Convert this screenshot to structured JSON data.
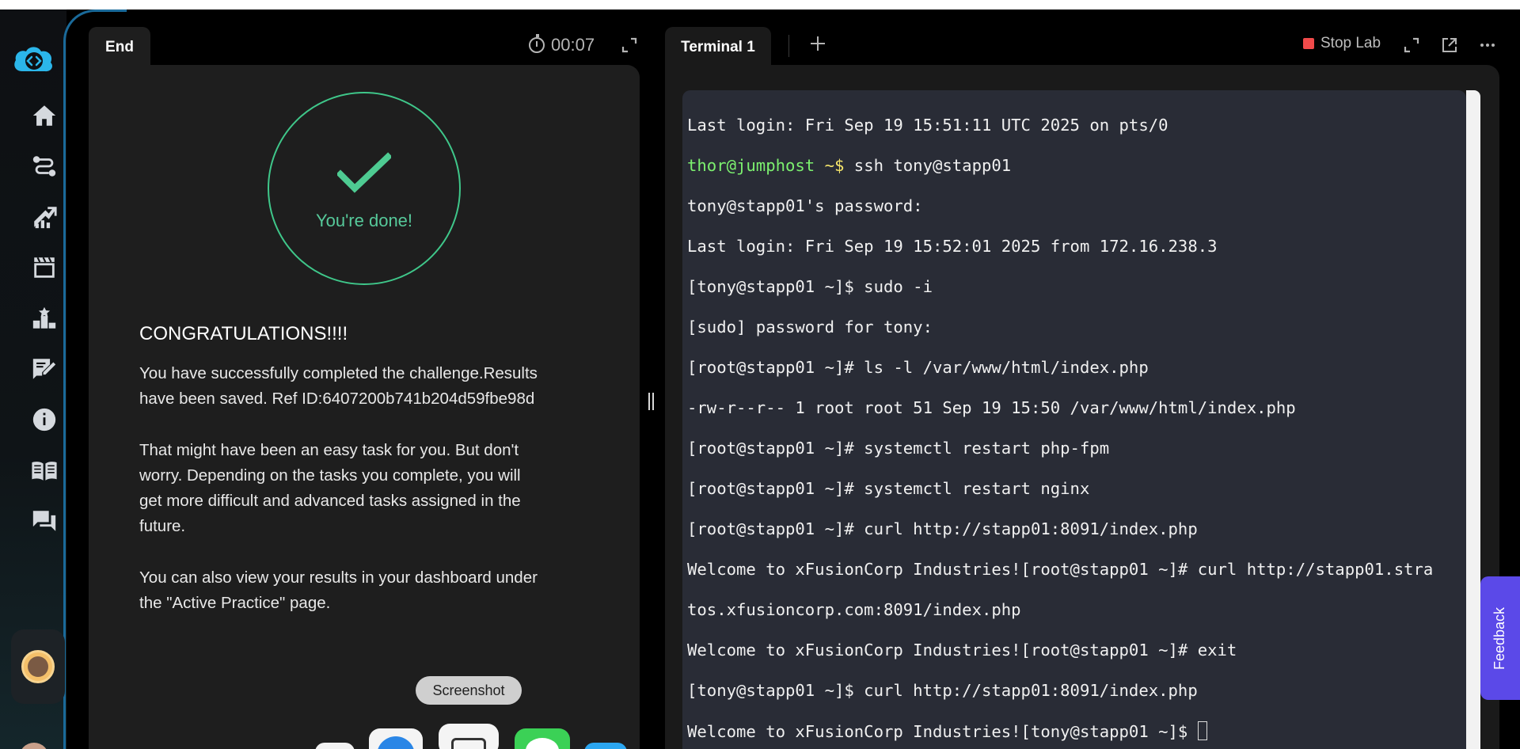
{
  "left_tab": {
    "label": "End"
  },
  "timer": {
    "value": "00:07"
  },
  "result": {
    "done_text": "You're done!",
    "heading": "CONGRATULATIONS!!!!",
    "para1_line1": "You have successfully completed the challenge.Results",
    "para1_line2": "have been saved. Ref ID:6407200b741b204d59fbe98d",
    "para2_line1": "That might have been an easy task for you. But don't",
    "para2_line2": "worry. Depending on the tasks you complete, you will",
    "para2_line3": "get more difficult and advanced tasks assigned in the",
    "para2_line4": "future.",
    "para3_line1": "You can also view your results in your dashboard under",
    "para3_line2": "the \"Active Practice\" page."
  },
  "dock": {
    "tooltip": "Screenshot"
  },
  "right_tab": {
    "label": "Terminal 1"
  },
  "toolbar": {
    "stop_label": "Stop Lab"
  },
  "terminal": {
    "l1": "Last login: Fri Sep 19 15:51:11 UTC 2025 on pts/0",
    "l2_user": "thor@jumphost",
    "l2_path": " ~$",
    "l2_cmd": " ssh tony@stapp01",
    "l3": "tony@stapp01's password:",
    "l4": "Last login: Fri Sep 19 15:52:01 2025 from 172.16.238.3",
    "l5": "[tony@stapp01 ~]$ sudo -i",
    "l6": "[sudo] password for tony:",
    "l7": "[root@stapp01 ~]# ls -l /var/www/html/index.php",
    "l8": "-rw-r--r-- 1 root root 51 Sep 19 15:50 /var/www/html/index.php",
    "l9": "[root@stapp01 ~]# systemctl restart php-fpm",
    "l10": "[root@stapp01 ~]# systemctl restart nginx",
    "l11": "[root@stapp01 ~]# curl http://stapp01:8091/index.php",
    "l12": "Welcome to xFusionCorp Industries![root@stapp01 ~]# curl http://stapp01.stra",
    "l13": "tos.xfusioncorp.com:8091/index.php",
    "l14": "Welcome to xFusionCorp Industries![root@stapp01 ~]# exit",
    "l15": "[tony@stapp01 ~]$ curl http://stapp01:8091/index.php",
    "l16": "Welcome to xFusionCorp Industries![tony@stapp01 ~]$ "
  },
  "feedback": {
    "label": "Feedback"
  },
  "colors": {
    "accent_green": "#3fc78a",
    "feedback_purple": "#5b49e8",
    "stop_red": "#f04a4a",
    "terminal_bg": "#292c36"
  }
}
